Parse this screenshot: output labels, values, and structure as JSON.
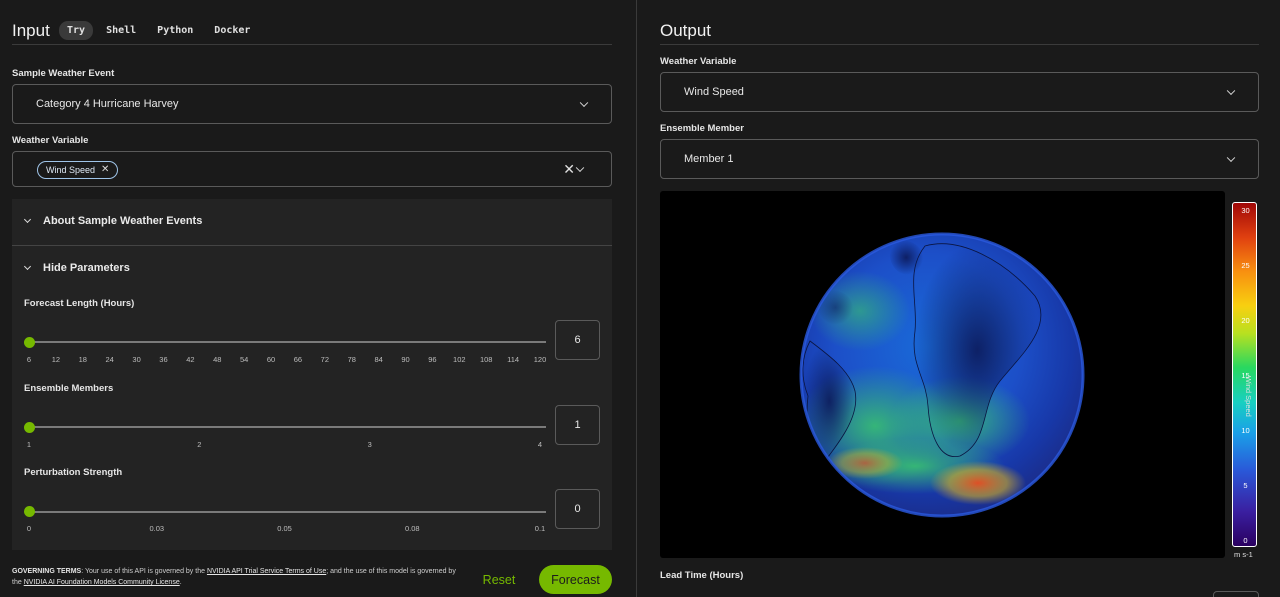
{
  "input": {
    "title": "Input",
    "tabs": [
      {
        "label": "Try",
        "active": true
      },
      {
        "label": "Shell",
        "active": false
      },
      {
        "label": "Python",
        "active": false
      },
      {
        "label": "Docker",
        "active": false
      }
    ],
    "sample_event": {
      "label": "Sample Weather Event",
      "value": "Category 4 Hurricane Harvey"
    },
    "weather_variable": {
      "label": "Weather Variable",
      "chip": "Wind Speed"
    },
    "accordion_about": "About Sample Weather Events",
    "accordion_params": "Hide Parameters",
    "sliders": {
      "forecast_length": {
        "label": "Forecast Length (Hours)",
        "value": "6",
        "ticks": [
          "6",
          "12",
          "18",
          "24",
          "30",
          "36",
          "42",
          "48",
          "54",
          "60",
          "66",
          "72",
          "78",
          "84",
          "90",
          "96",
          "102",
          "108",
          "114",
          "120"
        ]
      },
      "ensemble_members": {
        "label": "Ensemble Members",
        "value": "1",
        "ticks": [
          "1",
          "2",
          "3",
          "4"
        ]
      },
      "perturbation_strength": {
        "label": "Perturbation Strength",
        "value": "0",
        "ticks": [
          "0",
          "0.03",
          "0.05",
          "0.08",
          "0.1"
        ]
      }
    },
    "terms": {
      "heading": "GOVERNING TERMS",
      "text1": ": Your use of this API is governed by the ",
      "link1": "NVIDIA API Trial Service Terms of Use",
      "text2": "; and the use of this model is governed by the ",
      "link2": "NVIDIA AI Foundation Models Community License",
      "text3": "."
    },
    "reset_label": "Reset",
    "forecast_label": "Forecast"
  },
  "output": {
    "title": "Output",
    "weather_variable": {
      "label": "Weather Variable",
      "value": "Wind Speed"
    },
    "ensemble_member": {
      "label": "Ensemble Member",
      "value": "Member 1"
    },
    "colorbar": {
      "title": "Wind Speed",
      "unit": "m s-1",
      "ticks": [
        "30",
        "25",
        "20",
        "15",
        "10",
        "5",
        "0"
      ]
    },
    "lead_time_label": "Lead Time (Hours)"
  },
  "colors": {
    "accent": "#76b900",
    "background": "#1a1a1a",
    "panel": "#232323"
  }
}
